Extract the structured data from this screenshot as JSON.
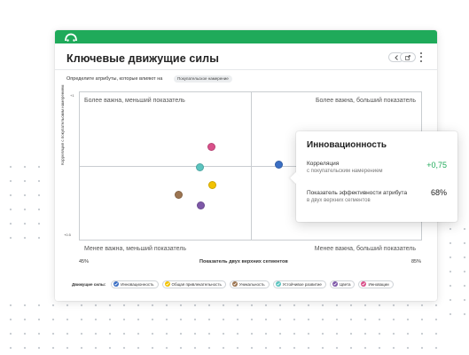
{
  "header": {
    "title": "Ключевые движущие силы",
    "prev_icon": "chevron-left-icon",
    "export_icon": "export-icon",
    "more_icon": "kebab-menu-icon"
  },
  "colors": {
    "topbar": "#1faa5a",
    "positive_value": "#1faa5a"
  },
  "filter": {
    "label": "Определите атрибуты, которые влияют на",
    "chip": "Покупательское намерение"
  },
  "quadrant": {
    "top_left": "Более важна, меньший показатель",
    "top_right": "Более важна, больший показатель",
    "bottom_left": "Менее важна, меньший показатель",
    "bottom_right": "Менее важна, больший показатель",
    "y_axis_label": "Корреляция с покупательским намерением",
    "y_top_tick": "+1",
    "y_bottom_tick": "+0.5",
    "x_axis_label": "Показатель двух верхних сегментов",
    "x_min": "45%",
    "x_max": "85%"
  },
  "legend": {
    "title": "Движущие силы:",
    "items": [
      {
        "label": "Инновационность",
        "color": "#3b6fc4"
      },
      {
        "label": "Общая привлекательность",
        "color": "#f2c200"
      },
      {
        "label": "Уникальность",
        "color": "#9c7552"
      },
      {
        "label": "Устойчивое развитие",
        "color": "#5bc4bf"
      },
      {
        "label": "Цвета",
        "color": "#7e58a8"
      },
      {
        "label": "Инновации",
        "color": "#d9508a"
      }
    ]
  },
  "points": [
    {
      "name": "Инновационность",
      "color": "#3b6fc4",
      "x": 0.579,
      "y": 0.513
    },
    {
      "name": "Инновации",
      "color": "#d9508a",
      "x": 0.384,
      "y": 0.631
    },
    {
      "name": "Устойчивое развитие",
      "color": "#5bc4bf",
      "x": 0.351,
      "y": 0.495
    },
    {
      "name": "Общая привлекательность",
      "color": "#f2c200",
      "x": 0.387,
      "y": 0.377
    },
    {
      "name": "Уникальность",
      "color": "#9c7552",
      "x": 0.287,
      "y": 0.314
    },
    {
      "name": "Цвета",
      "color": "#7e58a8",
      "x": 0.352,
      "y": 0.244
    }
  ],
  "tooltip": {
    "title": "Инновационность",
    "corr_label": "Корреляция",
    "corr_sub": "с покупательским намерением",
    "corr_value": "+0,75",
    "perf_label": "Показатель эффективности атрибута",
    "perf_sub": "в двух верхних сегментов",
    "perf_value": "68%"
  }
}
